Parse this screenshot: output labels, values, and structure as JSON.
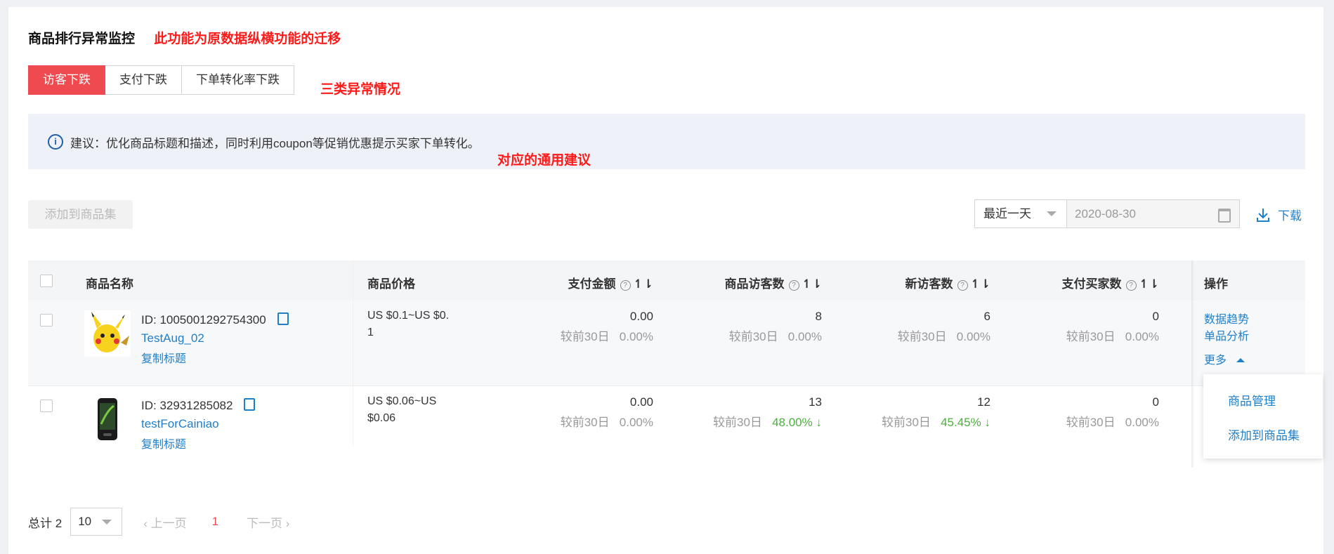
{
  "header": {
    "title": "商品排行异常监控",
    "note_migration": "此功能为原数据纵横功能的迁移",
    "note_three_types": "三类异常情况",
    "note_advice": "对应的通用建议"
  },
  "tabs": [
    {
      "label": "访客下跌",
      "active": true
    },
    {
      "label": "支付下跌",
      "active": false
    },
    {
      "label": "下单转化率下跌",
      "active": false
    }
  ],
  "tip": {
    "icon": "info-icon",
    "text": "建议：优化商品标题和描述，同时利用coupon等促销优惠提示买家下单转化。"
  },
  "toolbar": {
    "add_to_collection": "添加到商品集",
    "period_select": "最近一天",
    "date_value": "2020-08-30",
    "download": "下载"
  },
  "table": {
    "columns": {
      "name": "商品名称",
      "price": "商品价格",
      "pay_amount": "支付金额",
      "visitors": "商品访客数",
      "new_visitors": "新访客数",
      "buyers": "支付买家数",
      "actions": "操作"
    },
    "compare_label": "较前30日",
    "rows": [
      {
        "id": "ID: 1005001292754300",
        "name": "TestAug_02",
        "copy_title": "复制标题",
        "price_line1": "US $0.1~US $0.",
        "price_line2": "1",
        "pay_amount": "0.00",
        "pay_amount_change": "0.00%",
        "visitors": "8",
        "visitors_change": "0.00%",
        "new_visitors": "6",
        "new_visitors_change": "0.00%",
        "buyers": "0",
        "buyers_change": "0.00%",
        "action_trend": "数据趋势",
        "action_analysis": "单品分析",
        "action_more": "更多"
      },
      {
        "id": "ID: 32931285082",
        "name": "testForCainiao",
        "copy_title": "复制标题",
        "price_line1": "US $0.06~US",
        "price_line2": "$0.06",
        "pay_amount": "0.00",
        "pay_amount_change": "0.00%",
        "visitors": "13",
        "visitors_change": "48.00%",
        "new_visitors": "12",
        "new_visitors_change": "45.45%",
        "buyers": "0",
        "buyers_change": "0.00%"
      }
    ]
  },
  "more_menu": {
    "items": [
      "商品管理",
      "添加到商品集"
    ]
  },
  "pager": {
    "total": "总计 2",
    "page_size": "10",
    "prev": "上一页",
    "current": "1",
    "next": "下一页"
  }
}
